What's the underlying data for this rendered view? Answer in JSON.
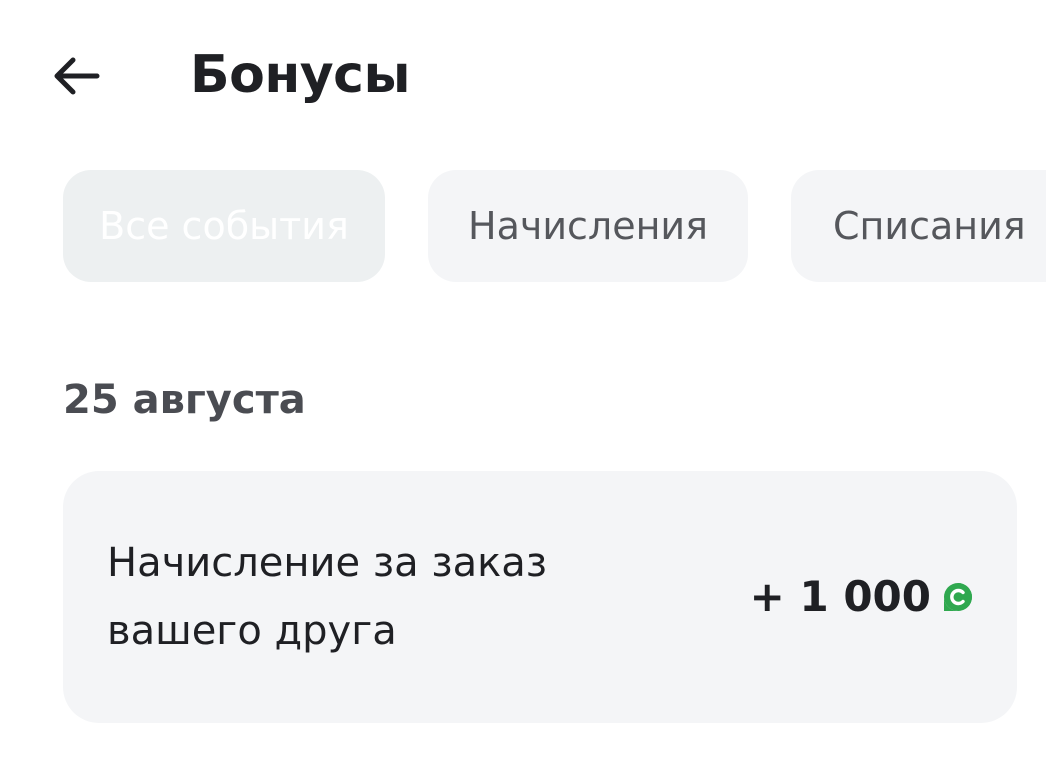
{
  "header": {
    "title": "Бонусы",
    "back_icon": "arrow-left-icon"
  },
  "tabs": [
    {
      "label": "Все события",
      "active": true
    },
    {
      "label": "Начисления",
      "active": false
    },
    {
      "label": "Списания",
      "active": false
    }
  ],
  "history": {
    "date": "25 августа",
    "events": [
      {
        "description": "Начисление за заказ вашего друга",
        "amount": "+ 1 000",
        "currency_icon": "bonus-coin-icon"
      }
    ]
  },
  "colors": {
    "accent_green": "#2fa84f",
    "text_dark": "#1f2024",
    "card_bg": "#f4f5f7"
  }
}
